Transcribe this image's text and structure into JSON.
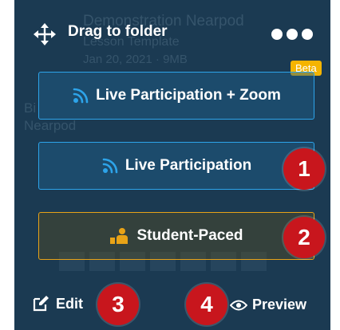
{
  "topbar": {
    "drag_label": "Drag to folder",
    "more_icon": "more-horizontal-icon"
  },
  "badge": {
    "beta_label": "Beta",
    "color": "#f5b400"
  },
  "buttons": {
    "live_zoom": {
      "label": "Live Participation + Zoom",
      "icon": "broadcast-icon"
    },
    "live": {
      "label": "Live Participation",
      "icon": "broadcast-icon"
    },
    "student_paced": {
      "label": "Student-Paced",
      "icon": "student-paced-icon"
    }
  },
  "bottombar": {
    "edit_label": "Edit",
    "preview_label": "Preview"
  },
  "callouts": [
    "1",
    "2",
    "3",
    "4"
  ],
  "background_card": {
    "title": "Demonstration Nearpod",
    "line1": "Lesson Template",
    "line2": "Jan 20, 2021 · 9MB",
    "left1": "Bi",
    "left2": "Nearpod"
  },
  "colors": {
    "card_bg": "#1b3a52",
    "live_accent": "#2da4ea",
    "paced_accent": "#e8a317",
    "callout": "#c8161d"
  }
}
